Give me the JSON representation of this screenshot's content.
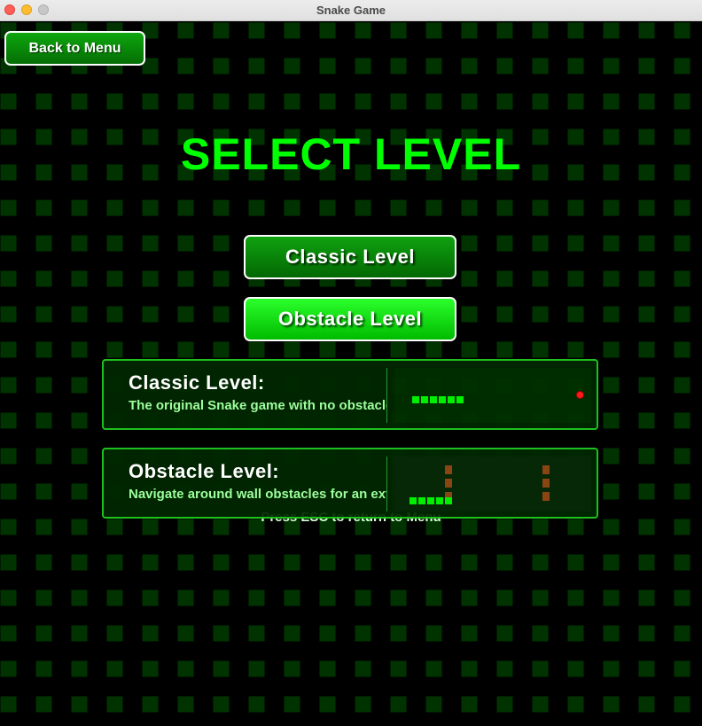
{
  "window": {
    "title": "Snake Game"
  },
  "nav": {
    "back_label": "Back to Menu"
  },
  "screen": {
    "title": "SELECT LEVEL",
    "esc_hint": "Press ESC to return to Menu"
  },
  "levels": {
    "classic_label": "Classic Level",
    "obstacle_label": "Obstacle Level",
    "selected": "Obstacle Level"
  },
  "cards": {
    "classic": {
      "heading": "Classic Level:",
      "description": "The original Snake game with no obstacles"
    },
    "obstacle": {
      "heading": "Obstacle Level:",
      "description": "Navigate around wall obstacles for an extra challenge"
    }
  },
  "colors": {
    "title": "#00ff00",
    "grid_tile": "#003300",
    "snake": "#00ee00",
    "food": "#ff1a1a",
    "wall": "#8b4513"
  }
}
